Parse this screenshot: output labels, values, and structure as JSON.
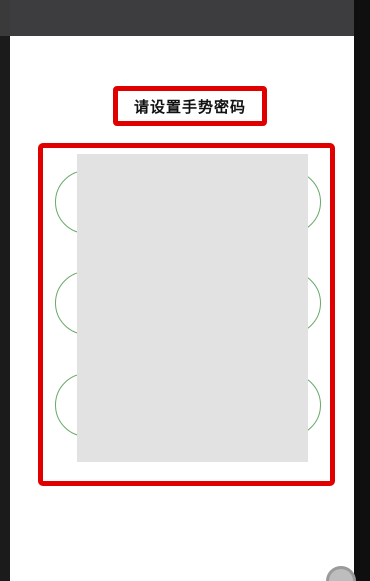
{
  "header": {
    "title": "请设置手势密码"
  },
  "gesture_grid": {
    "rows": 3,
    "cols": 3
  },
  "colors": {
    "highlight_border": "#e00000",
    "circle_stroke": "#6aa96a",
    "overlay": "#e2e2e2"
  }
}
